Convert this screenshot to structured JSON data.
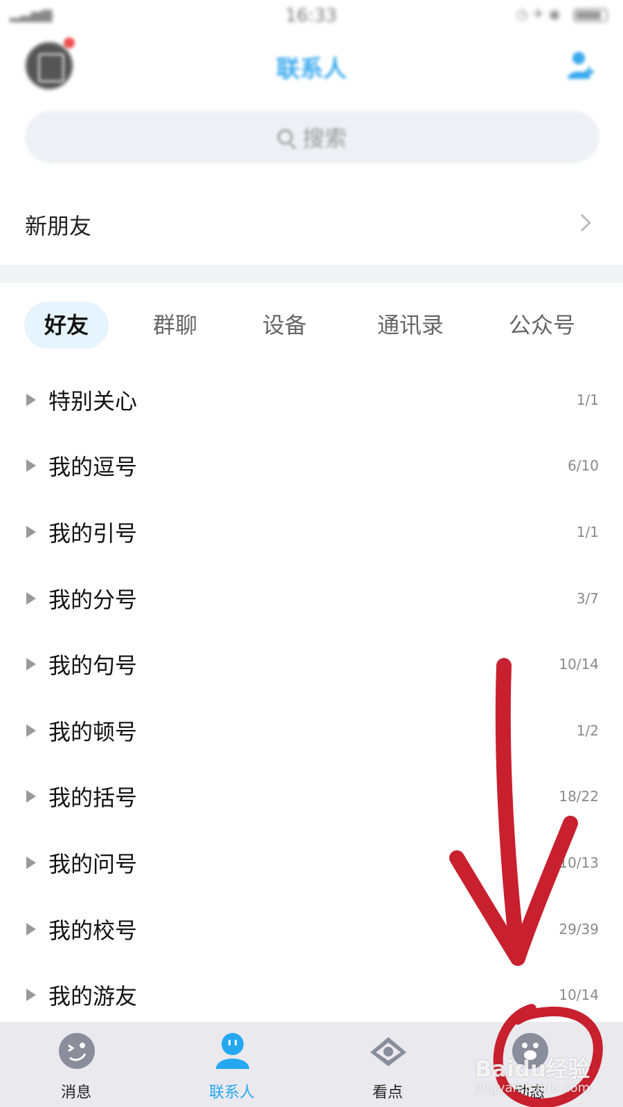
{
  "status_bar": {
    "time": "16:33"
  },
  "header": {
    "title": "联系人"
  },
  "search": {
    "placeholder": "搜索"
  },
  "new_friends": {
    "label": "新朋友"
  },
  "tabs": [
    {
      "label": "好友",
      "active": true
    },
    {
      "label": "群聊",
      "active": false
    },
    {
      "label": "设备",
      "active": false
    },
    {
      "label": "通讯录",
      "active": false
    },
    {
      "label": "公众号",
      "active": false
    }
  ],
  "groups": [
    {
      "name": "特别关心",
      "count": "1/1"
    },
    {
      "name": "我的逗号",
      "count": "6/10"
    },
    {
      "name": "我的引号",
      "count": "1/1"
    },
    {
      "name": "我的分号",
      "count": "3/7"
    },
    {
      "name": "我的句号",
      "count": "10/14"
    },
    {
      "name": "我的顿号",
      "count": "1/2"
    },
    {
      "name": "我的括号",
      "count": "18/22"
    },
    {
      "name": "我的问号",
      "count": "10/13"
    },
    {
      "name": "我的校号",
      "count": "29/39"
    },
    {
      "name": "我的游友",
      "count": "10/14"
    }
  ],
  "bottom_nav": [
    {
      "label": "消息",
      "icon": "message-icon",
      "active": false
    },
    {
      "label": "联系人",
      "icon": "contacts-icon",
      "active": true
    },
    {
      "label": "看点",
      "icon": "eye-icon",
      "active": false
    },
    {
      "label": "动态",
      "icon": "paw-icon",
      "active": false
    }
  ],
  "watermark": {
    "main": "Baidu经验",
    "sub": "jingyan.baidu.com"
  },
  "colors": {
    "accent": "#26a8f0",
    "annotation": "#c8202e",
    "tab_active_bg": "#e6f4fd",
    "nav_bg": "#e9e9ee"
  }
}
